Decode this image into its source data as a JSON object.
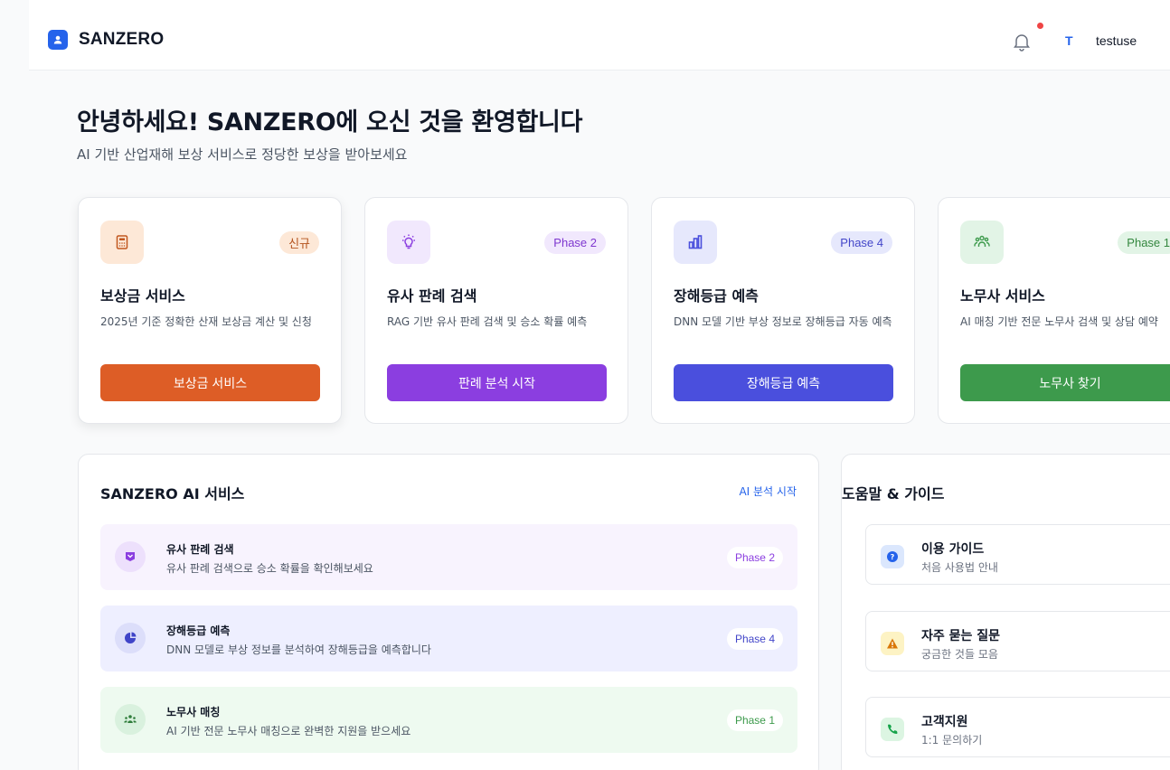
{
  "header": {
    "brand": "SANZERO",
    "user_initial": "T",
    "user_name": "testuse"
  },
  "welcome": {
    "title": "안녕하세요! SANZERO에 오신 것을 환영합니다",
    "subtitle": "AI 기반 산업재해 보상 서비스로 정당한 보상을 받아보세요"
  },
  "cards": [
    {
      "icon": "calculator-icon",
      "badge": "신규",
      "title": "보상금 서비스",
      "desc": "2025년 기준 정확한 산재 보상금 계산 및 신청",
      "button": "보상금 서비스",
      "color": "#dd5d26"
    },
    {
      "icon": "lightbulb-icon",
      "badge": "Phase 2",
      "title": "유사 판례 검색",
      "desc": "RAG 기반 유사 판례 검색 및 승소 확률 예측",
      "button": "판례 분석 시작",
      "color": "#8b3ee0"
    },
    {
      "icon": "bar-chart-icon",
      "badge": "Phase 4",
      "title": "장해등급 예측",
      "desc": "DNN 모델 기반 부상 정보로 장해등급 자동 예측",
      "button": "장해등급 예측",
      "color": "#4a4fdd"
    },
    {
      "icon": "users-icon",
      "badge": "Phase 1",
      "title": "노무사 서비스",
      "desc": "AI 매칭 기반 전문 노무사 검색 및 상담 예약",
      "button": "노무사 찾기",
      "color": "#3d9a4c"
    }
  ],
  "ai_panel": {
    "title": "SANZERO AI 서비스",
    "link": "AI 분석 시작",
    "items": [
      {
        "icon": "scale-icon",
        "title": "유사 판례 검색",
        "desc": "유사 판례 검색으로 승소 확률을 확인해보세요",
        "badge": "Phase 2"
      },
      {
        "icon": "pie-chart-icon",
        "title": "장해등급 예측",
        "desc": "DNN 모델로 부상 정보를 분석하여 장해등급을 예측합니다",
        "badge": "Phase 4"
      },
      {
        "icon": "people-icon",
        "title": "노무사 매칭",
        "desc": "AI 기반 전문 노무사 매칭으로 완벽한 지원을 받으세요",
        "badge": "Phase 1"
      }
    ]
  },
  "help_panel": {
    "title": "도움말 & 가이드",
    "items": [
      {
        "icon": "question-icon",
        "title": "이용 가이드",
        "desc": "처음 사용법 안내"
      },
      {
        "icon": "warning-icon",
        "title": "자주 묻는 질문",
        "desc": "궁금한 것들 모음"
      },
      {
        "icon": "phone-icon",
        "title": "고객지원",
        "desc": "1:1 문의하기"
      }
    ]
  }
}
